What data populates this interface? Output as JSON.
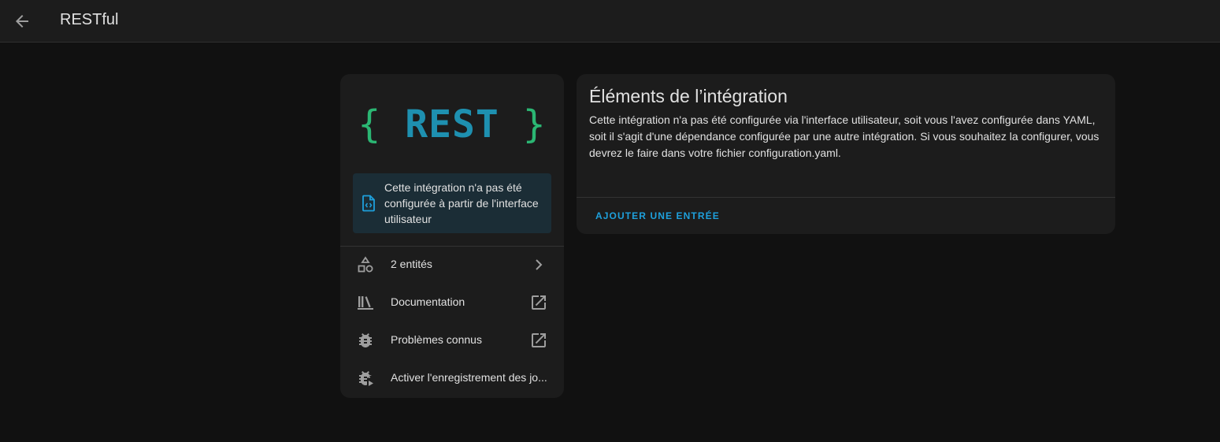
{
  "header": {
    "title": "RESTful",
    "back_icon": "arrow-left-icon"
  },
  "integration_card": {
    "logo": {
      "left_brace": "{",
      "word": "REST",
      "right_brace": "}"
    },
    "notice": {
      "icon": "file-code-icon",
      "text": "Cette intégration n'a pas été configurée à partir de l'interface utilisateur"
    },
    "items": [
      {
        "label": "2 entités",
        "icon": "shapes-icon",
        "trailing": "chevron-right-icon"
      },
      {
        "label": "Documentation",
        "icon": "bookshelf-icon",
        "trailing": "open-in-new-icon"
      },
      {
        "label": "Problèmes connus",
        "icon": "bug-icon",
        "trailing": "open-in-new-icon"
      },
      {
        "label": "Activer l'enregistrement des jo...",
        "icon": "bug-play-icon",
        "trailing": ""
      }
    ]
  },
  "entries_card": {
    "title": "Éléments de l’intégration",
    "description": "Cette intégration n'a pas été configurée via l'interface utilisateur, soit vous l'avez configurée dans YAML, soit il s'agit d'une dépendance configurée par une autre intégration. Si vous souhaitez la configurer, vous devrez le faire dans votre fichier configuration.yaml.",
    "add_button": "Ajouter une entrée"
  },
  "colors": {
    "background": "#111111",
    "card": "#1c1c1c",
    "accent": "#1ea0dc",
    "notice_bg": "#1b2d36",
    "logo_brace": "#2bb673",
    "logo_word": "#1e90b0"
  }
}
